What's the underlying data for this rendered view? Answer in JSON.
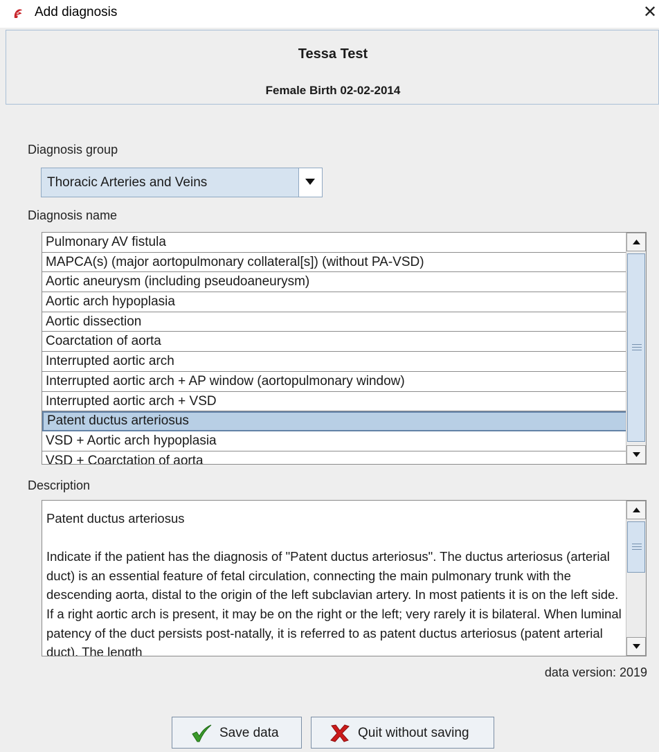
{
  "window": {
    "title": "Add diagnosis",
    "app_icon": "app-icon",
    "close_icon": "close-icon"
  },
  "patient": {
    "name": "Tessa Test",
    "details": "Female Birth 02-02-2014"
  },
  "group": {
    "label": "Diagnosis group",
    "selected": "Thoracic Arteries and Veins"
  },
  "names": {
    "label": "Diagnosis name",
    "items": [
      "Pulmonary AV fistula",
      "MAPCA(s) (major aortopulmonary collateral[s]) (without PA-VSD)",
      "Aortic aneurysm (including pseudoaneurysm)",
      "Aortic arch hypoplasia",
      "Aortic dissection",
      "Coarctation of aorta",
      "Interrupted aortic arch",
      "Interrupted aortic arch + AP window (aortopulmonary window)",
      "Interrupted aortic arch + VSD",
      "Patent ductus arteriosus",
      "VSD + Aortic arch hypoplasia",
      "VSD + Coarctation of aorta"
    ],
    "selected_index": 9
  },
  "description": {
    "label": "Description",
    "title": "Patent ductus arteriosus",
    "body": "Indicate if the patient has the diagnosis of \"Patent ductus arteriosus\". The ductus arteriosus (arterial duct) is an essential feature of fetal circulation, connecting the main pulmonary trunk with the descending aorta, distal to the origin of the left subclavian artery. In most patients it is on the left side. If a right aortic arch is present, it may be on the right or the left; very rarely it is bilateral. When luminal patency of the duct persists post-natally, it is referred to as patent ductus arteriosus (patent arterial duct). The length"
  },
  "footer": {
    "data_version": "data version: 2019",
    "save_label": "Save data",
    "quit_label": "Quit without saving",
    "save_icon": "checkmark-icon",
    "quit_icon": "x-icon",
    "save_icon_color": "#3a9a2a",
    "quit_icon_color": "#cc1a1a"
  },
  "colors": {
    "selection": "#b8cfe5",
    "accent_border": "#6382a6",
    "window_bg": "#eeeeee"
  }
}
